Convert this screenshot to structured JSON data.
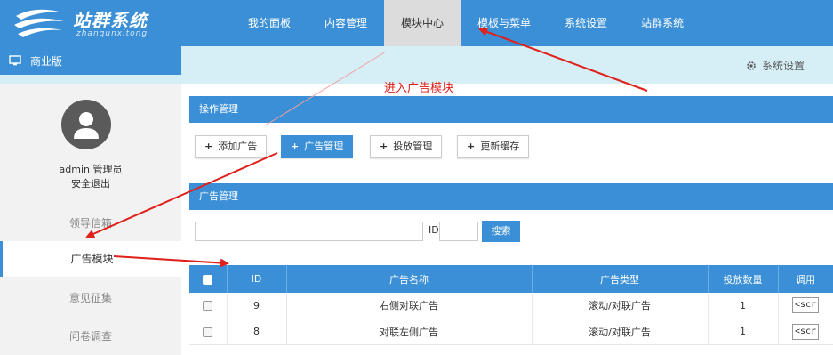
{
  "logo": {
    "title": "站群系统",
    "subtitle": "zhanqunxitong"
  },
  "nav": [
    {
      "label": "我的面板",
      "active": false
    },
    {
      "label": "内容管理",
      "active": false
    },
    {
      "label": "模块中心",
      "active": true
    },
    {
      "label": "模板与菜单",
      "active": false
    },
    {
      "label": "系统设置",
      "active": false
    },
    {
      "label": "站群系统",
      "active": false
    }
  ],
  "edition": {
    "label": "商业版",
    "icon": "monitor-icon"
  },
  "system_settings": {
    "label": "系统设置",
    "icon": "gear-icon"
  },
  "user": {
    "name": "admin 管理员",
    "logout": "安全退出",
    "avatar_icon": "user-avatar-icon"
  },
  "sidebar": {
    "items": [
      {
        "label": "领导信箱",
        "active": false
      },
      {
        "label": "广告模块",
        "active": true
      },
      {
        "label": "意见征集",
        "active": false
      },
      {
        "label": "问卷调查",
        "active": false
      }
    ]
  },
  "annotation": "进入广告模块",
  "operations": {
    "title": "操作管理",
    "buttons": [
      {
        "label": "添加广告",
        "primary": false
      },
      {
        "label": "广告管理",
        "primary": true
      },
      {
        "label": "投放管理",
        "primary": false
      },
      {
        "label": "更新缓存",
        "primary": false
      }
    ]
  },
  "ad_management": {
    "title": "广告管理",
    "search_value": "",
    "id_label": "ID",
    "id_value": "",
    "search_button": "搜索"
  },
  "table": {
    "headers": [
      "ID",
      "广告名称",
      "广告类型",
      "投放数量",
      "调用"
    ],
    "rows": [
      {
        "id": "9",
        "name": "右侧对联广告",
        "type": "滚动/对联广告",
        "count": "1",
        "call": "<scr"
      },
      {
        "id": "8",
        "name": "对联左侧广告",
        "type": "滚动/对联广告",
        "count": "1",
        "call": "<scr"
      }
    ]
  },
  "colors": {
    "primary": "#3a8fd6",
    "subbar": "#d6eef5",
    "sidebar": "#f2f2f2",
    "annotation": "#e0201a"
  }
}
